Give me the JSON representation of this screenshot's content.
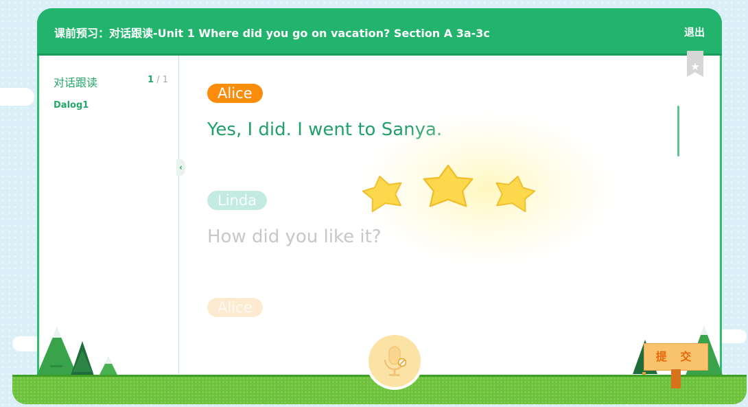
{
  "header": {
    "title": "课前预习：对话跟读-Unit 1 Where did you go on vacation? Section A 3a-3c",
    "exit_label": "退出"
  },
  "sidebar": {
    "section_title": "对话跟读",
    "pager": {
      "current": "1",
      "separator": "/",
      "total": "1"
    },
    "items": [
      {
        "label": "Dalog1"
      }
    ]
  },
  "dialog": {
    "lines": [
      {
        "speaker": "Alice",
        "text": "Yes, I did. I went to Sanya.",
        "state": "active"
      },
      {
        "speaker": "Linda",
        "text": "How did you like it?",
        "state": "inactive"
      },
      {
        "speaker": "Alice",
        "text": "",
        "state": "inactive"
      }
    ]
  },
  "feedback": {
    "stars_earned": 3,
    "stars_total": 3
  },
  "controls": {
    "mic_state": "disabled",
    "submit_label": "提 交"
  },
  "icons": {
    "collapse": "chevron-left-icon",
    "bookmark": "star-bookmark-icon",
    "mic": "microphone-icon",
    "mic_disabled": "prohibited-icon"
  },
  "colors": {
    "brand_green": "#22b36d",
    "alice_badge": "#fc8c0c",
    "linda_badge": "#a9e0d5",
    "active_text": "#22a06b",
    "inactive_text": "#c2c2c2",
    "star": "#fbd84c",
    "submit_text": "#e86a0d"
  }
}
